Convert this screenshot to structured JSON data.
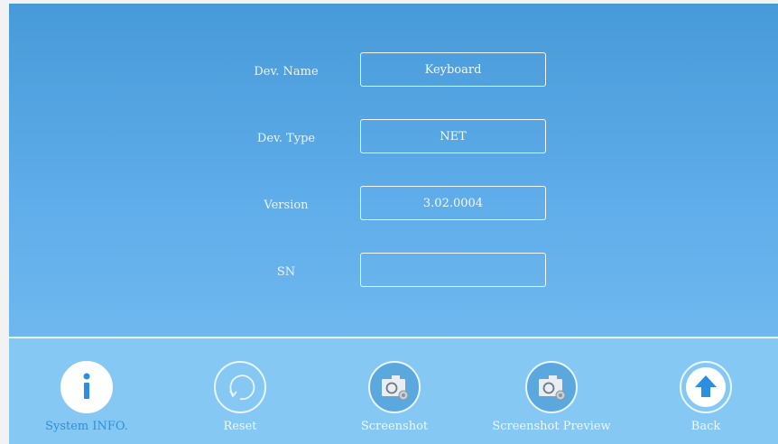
{
  "fields": [
    {
      "label": "Dev. Name",
      "value": "Keyboard"
    },
    {
      "label": "Dev. Type",
      "value": "NET"
    },
    {
      "label": "Version",
      "value": "3.02.0004"
    },
    {
      "label": "SN",
      "value": ""
    }
  ],
  "toolbar": [
    {
      "label": "System INFO.",
      "icon": "info-icon",
      "active": true
    },
    {
      "label": "Reset",
      "icon": "reset-icon",
      "active": false
    },
    {
      "label": "Screenshot",
      "icon": "camera-icon",
      "active": false
    },
    {
      "label": "Screenshot Preview",
      "icon": "camera-icon",
      "active": false
    },
    {
      "label": "Back",
      "icon": "arrow-up-icon",
      "active": false
    }
  ],
  "colors": {
    "accent": "#2a8fe0",
    "background_top": "#479ad8",
    "background_bottom": "#7cc0f2"
  }
}
